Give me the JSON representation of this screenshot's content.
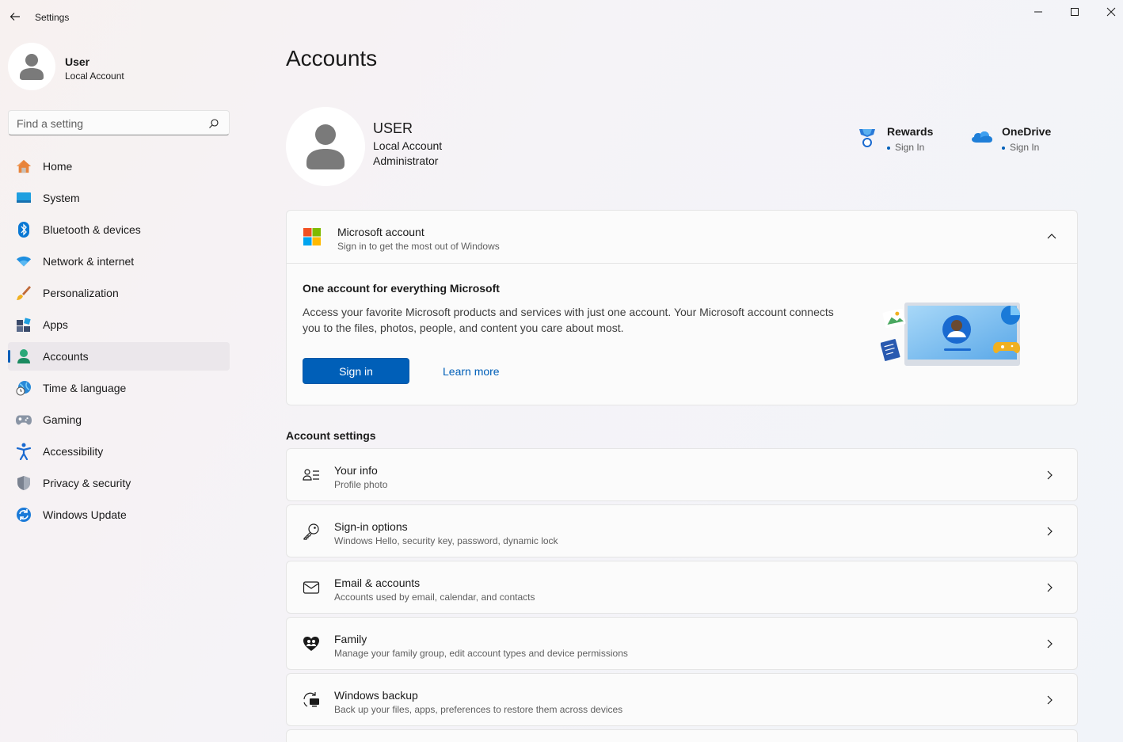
{
  "window": {
    "title": "Settings"
  },
  "sidebar": {
    "user": {
      "name": "User",
      "type": "Local Account"
    },
    "search_placeholder": "Find a setting",
    "items": [
      {
        "label": "Home",
        "icon": "home-icon"
      },
      {
        "label": "System",
        "icon": "system-icon"
      },
      {
        "label": "Bluetooth & devices",
        "icon": "bluetooth-icon"
      },
      {
        "label": "Network & internet",
        "icon": "wifi-icon"
      },
      {
        "label": "Personalization",
        "icon": "brush-icon"
      },
      {
        "label": "Apps",
        "icon": "apps-icon"
      },
      {
        "label": "Accounts",
        "icon": "accounts-icon",
        "active": true
      },
      {
        "label": "Time & language",
        "icon": "globe-clock-icon"
      },
      {
        "label": "Gaming",
        "icon": "gamepad-icon"
      },
      {
        "label": "Accessibility",
        "icon": "accessibility-icon"
      },
      {
        "label": "Privacy & security",
        "icon": "shield-icon"
      },
      {
        "label": "Windows Update",
        "icon": "update-icon"
      }
    ]
  },
  "main": {
    "title": "Accounts",
    "profile": {
      "name": "USER",
      "line1": "Local Account",
      "line2": "Administrator"
    },
    "services": [
      {
        "name": "Rewards",
        "status": "Sign In",
        "icon": "rewards-icon"
      },
      {
        "name": "OneDrive",
        "status": "Sign In",
        "icon": "onedrive-icon"
      }
    ],
    "ms_account": {
      "title": "Microsoft account",
      "subtitle": "Sign in to get the most out of Windows",
      "body_title": "One account for everything Microsoft",
      "body_desc": "Access your favorite Microsoft products and services with just one account. Your Microsoft account connects you to the files, photos, people, and content you care about most.",
      "signin_label": "Sign in",
      "learn_more": "Learn more"
    },
    "section_title": "Account settings",
    "settings": [
      {
        "title": "Your info",
        "subtitle": "Profile photo",
        "icon": "person-list-icon"
      },
      {
        "title": "Sign-in options",
        "subtitle": "Windows Hello, security key, password, dynamic lock",
        "icon": "key-icon"
      },
      {
        "title": "Email & accounts",
        "subtitle": "Accounts used by email, calendar, and contacts",
        "icon": "mail-icon"
      },
      {
        "title": "Family",
        "subtitle": "Manage your family group, edit account types and device permissions",
        "icon": "family-heart-icon"
      },
      {
        "title": "Windows backup",
        "subtitle": "Back up your files, apps, preferences to restore them across devices",
        "icon": "backup-icon"
      }
    ]
  },
  "colors": {
    "accent": "#005fb8",
    "nav_active_bg": "#ebe7eb",
    "card_bg": "#fbfbfb"
  }
}
